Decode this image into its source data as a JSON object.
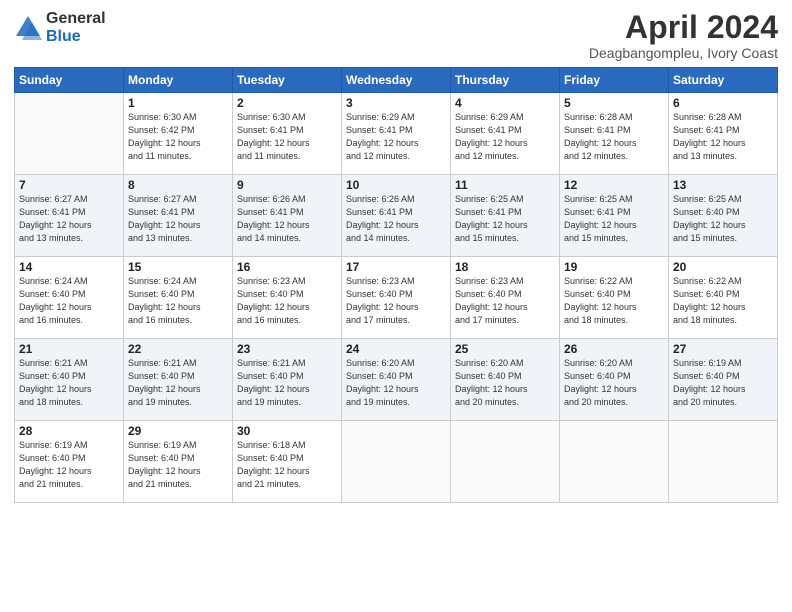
{
  "logo": {
    "general": "General",
    "blue": "Blue"
  },
  "title": "April 2024",
  "subtitle": "Deagbangompleu, Ivory Coast",
  "days_header": [
    "Sunday",
    "Monday",
    "Tuesday",
    "Wednesday",
    "Thursday",
    "Friday",
    "Saturday"
  ],
  "weeks": [
    [
      {
        "num": "",
        "info": ""
      },
      {
        "num": "1",
        "info": "Sunrise: 6:30 AM\nSunset: 6:42 PM\nDaylight: 12 hours\nand 11 minutes."
      },
      {
        "num": "2",
        "info": "Sunrise: 6:30 AM\nSunset: 6:41 PM\nDaylight: 12 hours\nand 11 minutes."
      },
      {
        "num": "3",
        "info": "Sunrise: 6:29 AM\nSunset: 6:41 PM\nDaylight: 12 hours\nand 12 minutes."
      },
      {
        "num": "4",
        "info": "Sunrise: 6:29 AM\nSunset: 6:41 PM\nDaylight: 12 hours\nand 12 minutes."
      },
      {
        "num": "5",
        "info": "Sunrise: 6:28 AM\nSunset: 6:41 PM\nDaylight: 12 hours\nand 12 minutes."
      },
      {
        "num": "6",
        "info": "Sunrise: 6:28 AM\nSunset: 6:41 PM\nDaylight: 12 hours\nand 13 minutes."
      }
    ],
    [
      {
        "num": "7",
        "info": "Sunrise: 6:27 AM\nSunset: 6:41 PM\nDaylight: 12 hours\nand 13 minutes."
      },
      {
        "num": "8",
        "info": "Sunrise: 6:27 AM\nSunset: 6:41 PM\nDaylight: 12 hours\nand 13 minutes."
      },
      {
        "num": "9",
        "info": "Sunrise: 6:26 AM\nSunset: 6:41 PM\nDaylight: 12 hours\nand 14 minutes."
      },
      {
        "num": "10",
        "info": "Sunrise: 6:26 AM\nSunset: 6:41 PM\nDaylight: 12 hours\nand 14 minutes."
      },
      {
        "num": "11",
        "info": "Sunrise: 6:25 AM\nSunset: 6:41 PM\nDaylight: 12 hours\nand 15 minutes."
      },
      {
        "num": "12",
        "info": "Sunrise: 6:25 AM\nSunset: 6:41 PM\nDaylight: 12 hours\nand 15 minutes."
      },
      {
        "num": "13",
        "info": "Sunrise: 6:25 AM\nSunset: 6:40 PM\nDaylight: 12 hours\nand 15 minutes."
      }
    ],
    [
      {
        "num": "14",
        "info": "Sunrise: 6:24 AM\nSunset: 6:40 PM\nDaylight: 12 hours\nand 16 minutes."
      },
      {
        "num": "15",
        "info": "Sunrise: 6:24 AM\nSunset: 6:40 PM\nDaylight: 12 hours\nand 16 minutes."
      },
      {
        "num": "16",
        "info": "Sunrise: 6:23 AM\nSunset: 6:40 PM\nDaylight: 12 hours\nand 16 minutes."
      },
      {
        "num": "17",
        "info": "Sunrise: 6:23 AM\nSunset: 6:40 PM\nDaylight: 12 hours\nand 17 minutes."
      },
      {
        "num": "18",
        "info": "Sunrise: 6:23 AM\nSunset: 6:40 PM\nDaylight: 12 hours\nand 17 minutes."
      },
      {
        "num": "19",
        "info": "Sunrise: 6:22 AM\nSunset: 6:40 PM\nDaylight: 12 hours\nand 18 minutes."
      },
      {
        "num": "20",
        "info": "Sunrise: 6:22 AM\nSunset: 6:40 PM\nDaylight: 12 hours\nand 18 minutes."
      }
    ],
    [
      {
        "num": "21",
        "info": "Sunrise: 6:21 AM\nSunset: 6:40 PM\nDaylight: 12 hours\nand 18 minutes."
      },
      {
        "num": "22",
        "info": "Sunrise: 6:21 AM\nSunset: 6:40 PM\nDaylight: 12 hours\nand 19 minutes."
      },
      {
        "num": "23",
        "info": "Sunrise: 6:21 AM\nSunset: 6:40 PM\nDaylight: 12 hours\nand 19 minutes."
      },
      {
        "num": "24",
        "info": "Sunrise: 6:20 AM\nSunset: 6:40 PM\nDaylight: 12 hours\nand 19 minutes."
      },
      {
        "num": "25",
        "info": "Sunrise: 6:20 AM\nSunset: 6:40 PM\nDaylight: 12 hours\nand 20 minutes."
      },
      {
        "num": "26",
        "info": "Sunrise: 6:20 AM\nSunset: 6:40 PM\nDaylight: 12 hours\nand 20 minutes."
      },
      {
        "num": "27",
        "info": "Sunrise: 6:19 AM\nSunset: 6:40 PM\nDaylight: 12 hours\nand 20 minutes."
      }
    ],
    [
      {
        "num": "28",
        "info": "Sunrise: 6:19 AM\nSunset: 6:40 PM\nDaylight: 12 hours\nand 21 minutes."
      },
      {
        "num": "29",
        "info": "Sunrise: 6:19 AM\nSunset: 6:40 PM\nDaylight: 12 hours\nand 21 minutes."
      },
      {
        "num": "30",
        "info": "Sunrise: 6:18 AM\nSunset: 6:40 PM\nDaylight: 12 hours\nand 21 minutes."
      },
      {
        "num": "",
        "info": ""
      },
      {
        "num": "",
        "info": ""
      },
      {
        "num": "",
        "info": ""
      },
      {
        "num": "",
        "info": ""
      }
    ]
  ]
}
